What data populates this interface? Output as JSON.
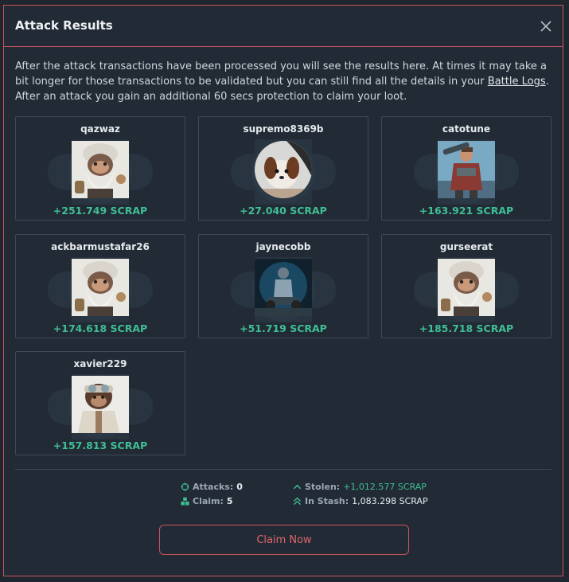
{
  "modal": {
    "title": "Attack Results",
    "close_icon": "close-icon",
    "intro_part1": "After the attack transactions have been processed you will see the results here. At times it may take a bit longer for those transactions to be validated but you can still find all the details in your ",
    "intro_link": "Battle Logs",
    "intro_part2": ". After an attack you gain an additional 60 secs protection to claim your loot."
  },
  "results": [
    {
      "name": "qazwaz",
      "amount": "+251.749 SCRAP",
      "avatar": "bearded-monkey"
    },
    {
      "name": "supremo8369b",
      "amount": "+27.040 SCRAP",
      "avatar": "puppy"
    },
    {
      "name": "catotune",
      "amount": "+163.921 SCRAP",
      "avatar": "soldier"
    },
    {
      "name": "ackbarmustafar26",
      "amount": "+174.618 SCRAP",
      "avatar": "bearded-monkey"
    },
    {
      "name": "jaynecobb",
      "amount": "+51.719 SCRAP",
      "avatar": "astronaut"
    },
    {
      "name": "gurseerat",
      "amount": "+185.718 SCRAP",
      "avatar": "bearded-monkey"
    },
    {
      "name": "xavier229",
      "amount": "+157.813 SCRAP",
      "avatar": "goggle-monkey"
    }
  ],
  "summary": {
    "attacks_label": "Attacks:",
    "attacks_value": "0",
    "claim_label": "Claim:",
    "claim_value": "5",
    "stolen_label": "Stolen:",
    "stolen_value": "+1,012.577 SCRAP",
    "stash_label": "In Stash:",
    "stash_value": "1,083.298 SCRAP"
  },
  "claim_button": "Claim Now",
  "colors": {
    "accent": "#c9555c",
    "positive": "#3fbf95",
    "background": "#222b35"
  }
}
